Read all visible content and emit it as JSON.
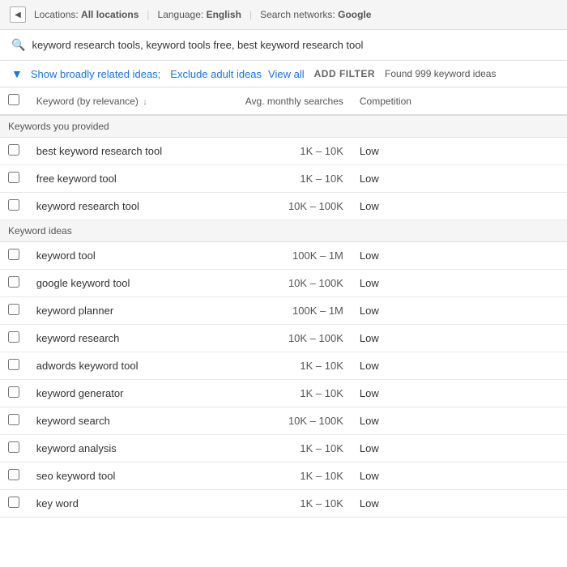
{
  "topbar": {
    "back_label": "◀",
    "locations_label": "Locations:",
    "locations_value": "All locations",
    "language_label": "Language:",
    "language_value": "English",
    "networks_label": "Search networks:",
    "networks_value": "Google"
  },
  "search": {
    "query": "keyword research tools, keyword tools free, best keyword research tool",
    "placeholder": "keyword research tools, keyword tools free, best keyword research tool"
  },
  "filters": {
    "show_broadly": "Show broadly related ideas;",
    "exclude_adult": "Exclude adult ideas",
    "view_all": "View all",
    "add_filter": "ADD FILTER",
    "found_text": "Found 999 keyword ideas"
  },
  "table": {
    "col_keyword": "Keyword (by relevance)",
    "col_avg": "Avg. monthly searches",
    "col_competition": "Competition",
    "sections": [
      {
        "section_label": "Keywords you provided",
        "rows": [
          {
            "keyword": "best keyword research tool",
            "avg": "1K – 10K",
            "competition": "Low"
          },
          {
            "keyword": "free keyword tool",
            "avg": "1K – 10K",
            "competition": "Low"
          },
          {
            "keyword": "keyword research tool",
            "avg": "10K – 100K",
            "competition": "Low"
          }
        ]
      },
      {
        "section_label": "Keyword ideas",
        "rows": [
          {
            "keyword": "keyword tool",
            "avg": "100K – 1M",
            "competition": "Low"
          },
          {
            "keyword": "google keyword tool",
            "avg": "10K – 100K",
            "competition": "Low"
          },
          {
            "keyword": "keyword planner",
            "avg": "100K – 1M",
            "competition": "Low"
          },
          {
            "keyword": "keyword research",
            "avg": "10K – 100K",
            "competition": "Low"
          },
          {
            "keyword": "adwords keyword tool",
            "avg": "1K – 10K",
            "competition": "Low"
          },
          {
            "keyword": "keyword generator",
            "avg": "1K – 10K",
            "competition": "Low"
          },
          {
            "keyword": "keyword search",
            "avg": "10K – 100K",
            "competition": "Low"
          },
          {
            "keyword": "keyword analysis",
            "avg": "1K – 10K",
            "competition": "Low"
          },
          {
            "keyword": "seo keyword tool",
            "avg": "1K – 10K",
            "competition": "Low"
          },
          {
            "keyword": "key word",
            "avg": "1K – 10K",
            "competition": "Low"
          }
        ]
      }
    ]
  }
}
